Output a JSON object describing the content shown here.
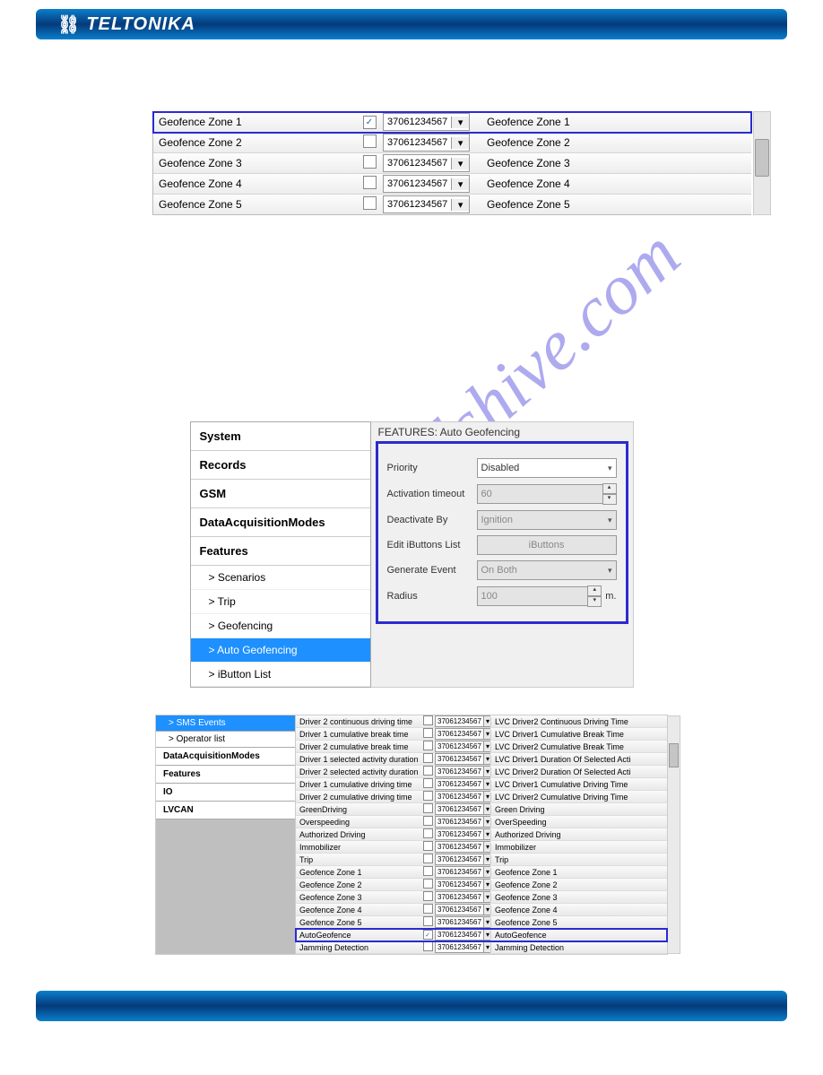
{
  "brand": "TELTONIKA",
  "watermark": "manualshive.com",
  "blockA": {
    "rows": [
      {
        "name": "Geofence Zone 1",
        "checked": true,
        "phone": "37061234567",
        "desc": "Geofence Zone 1"
      },
      {
        "name": "Geofence Zone 2",
        "checked": false,
        "phone": "37061234567",
        "desc": "Geofence Zone 2"
      },
      {
        "name": "Geofence Zone 3",
        "checked": false,
        "phone": "37061234567",
        "desc": "Geofence Zone 3"
      },
      {
        "name": "Geofence Zone 4",
        "checked": false,
        "phone": "37061234567",
        "desc": "Geofence Zone 4"
      },
      {
        "name": "Geofence Zone 5",
        "checked": false,
        "phone": "37061234567",
        "desc": "Geofence Zone 5"
      }
    ]
  },
  "blockB": {
    "nav": [
      {
        "label": "System",
        "type": "item"
      },
      {
        "label": "Records",
        "type": "item"
      },
      {
        "label": "GSM",
        "type": "item"
      },
      {
        "label": "DataAcquisitionModes",
        "type": "item"
      },
      {
        "label": "Features",
        "type": "item"
      },
      {
        "label": "> Scenarios",
        "type": "sub"
      },
      {
        "label": "> Trip",
        "type": "sub"
      },
      {
        "label": "> Geofencing",
        "type": "sub"
      },
      {
        "label": "> Auto Geofencing",
        "type": "sub",
        "active": true
      },
      {
        "label": "> iButton List",
        "type": "sub"
      }
    ],
    "panel_title": "FEATURES: Auto Geofencing",
    "rows": {
      "priority_label": "Priority",
      "priority_value": "Disabled",
      "timeout_label": "Activation timeout",
      "timeout_value": "60",
      "deact_label": "Deactivate By",
      "deact_value": "Ignition",
      "edit_label": "Edit iButtons List",
      "edit_btn": "iButtons",
      "gen_label": "Generate Event",
      "gen_value": "On Both",
      "radius_label": "Radius",
      "radius_value": "100",
      "radius_unit": "m."
    }
  },
  "blockC": {
    "nav": [
      {
        "label": "> SMS Events",
        "type": "sub",
        "active": true
      },
      {
        "label": "> Operator list",
        "type": "sub"
      },
      {
        "label": "DataAcquisitionModes",
        "type": "item"
      },
      {
        "label": "Features",
        "type": "item"
      },
      {
        "label": "IO",
        "type": "item"
      },
      {
        "label": "LVCAN",
        "type": "item"
      }
    ],
    "rows": [
      {
        "name": "Driver 2 continuous driving time",
        "checked": false,
        "phone": "37061234567",
        "desc": "LVC Driver2 Continuous Driving Time"
      },
      {
        "name": "Driver 1 cumulative break time",
        "checked": false,
        "phone": "37061234567",
        "desc": "LVC Driver1 Cumulative Break Time"
      },
      {
        "name": "Driver 2 cumulative break time",
        "checked": false,
        "phone": "37061234567",
        "desc": "LVC Driver2 Cumulative Break Time"
      },
      {
        "name": "Driver 1 selected activity duration",
        "checked": false,
        "phone": "37061234567",
        "desc": "LVC Driver1 Duration Of Selected Acti"
      },
      {
        "name": "Driver 2 selected activity duration",
        "checked": false,
        "phone": "37061234567",
        "desc": "LVC Driver2 Duration Of Selected Acti"
      },
      {
        "name": "Driver 1 cumulative driving time",
        "checked": false,
        "phone": "37061234567",
        "desc": "LVC Driver1 Cumulative Driving Time"
      },
      {
        "name": "Driver 2 cumulative driving time",
        "checked": false,
        "phone": "37061234567",
        "desc": "LVC Driver2 Cumulative Driving Time"
      },
      {
        "name": "GreenDriving",
        "checked": false,
        "phone": "37061234567",
        "desc": "Green Driving"
      },
      {
        "name": "Overspeeding",
        "checked": false,
        "phone": "37061234567",
        "desc": "OverSpeeding"
      },
      {
        "name": "Authorized Driving",
        "checked": false,
        "phone": "37061234567",
        "desc": "Authorized Driving"
      },
      {
        "name": "Immobilizer",
        "checked": false,
        "phone": "37061234567",
        "desc": "Immobilizer"
      },
      {
        "name": "Trip",
        "checked": false,
        "phone": "37061234567",
        "desc": "Trip"
      },
      {
        "name": "Geofence Zone 1",
        "checked": false,
        "phone": "37061234567",
        "desc": "Geofence Zone 1"
      },
      {
        "name": "Geofence Zone 2",
        "checked": false,
        "phone": "37061234567",
        "desc": "Geofence Zone 2"
      },
      {
        "name": "Geofence Zone 3",
        "checked": false,
        "phone": "37061234567",
        "desc": "Geofence Zone 3"
      },
      {
        "name": "Geofence Zone 4",
        "checked": false,
        "phone": "37061234567",
        "desc": "Geofence Zone 4"
      },
      {
        "name": "Geofence Zone 5",
        "checked": false,
        "phone": "37061234567",
        "desc": "Geofence Zone 5"
      },
      {
        "name": "AutoGeofence",
        "checked": true,
        "phone": "37061234567",
        "desc": "AutoGeofence",
        "hl": true
      },
      {
        "name": "Jamming Detection",
        "checked": false,
        "phone": "37061234567",
        "desc": "Jamming Detection"
      }
    ]
  }
}
